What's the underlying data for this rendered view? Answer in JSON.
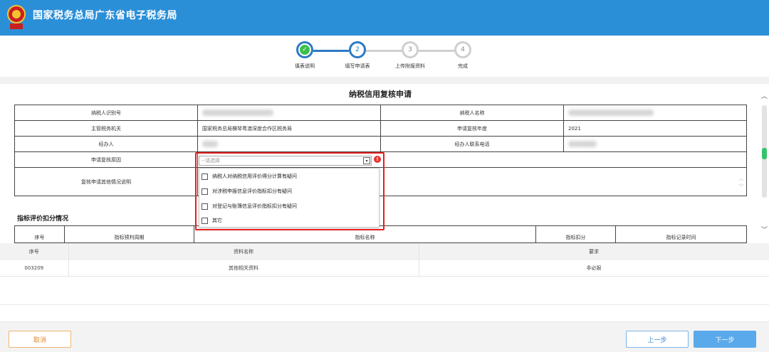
{
  "header": {
    "title": "国家税务总局广东省电子税务局",
    "brand_color": "#2b8fd8"
  },
  "stepper": {
    "steps": [
      {
        "number": "✓",
        "label": "填表说明",
        "state": "done"
      },
      {
        "number": "2",
        "label": "填写申请表",
        "state": "current"
      },
      {
        "number": "3",
        "label": "上传附报资料",
        "state": "todo"
      },
      {
        "number": "4",
        "label": "完成",
        "state": "todo"
      }
    ]
  },
  "form": {
    "title": "纳税信用复核申请",
    "rows": {
      "taxpayer_id_label": "纳税人识别号",
      "taxpayer_name_label": "纳税人名称",
      "tax_authority_label": "主管税务机关",
      "tax_authority_value": "国家税务总局横琴粤澳深度合作区税务局",
      "review_year_label": "申请复核年度",
      "review_year_value": "2021",
      "agent_label": "经办人",
      "agent_phone_label": "经办人联系电话",
      "reason_label": "申请复核原因",
      "other_label": "复核申请其他情况说明"
    },
    "reason_select": {
      "placeholder": "--请选择",
      "options": [
        "纳税人对纳税信用评价得分计算有疑问",
        "对涉税申报信息评价指标扣分有疑问",
        "对登记与账簿信息评价指标扣分有疑问",
        "其它"
      ]
    }
  },
  "index_section": {
    "title": "指标评价扣分情况",
    "columns": [
      "序号",
      "指标预判周期",
      "指标名称",
      "指标扣分",
      "指标记录时间"
    ]
  },
  "files": {
    "columns": [
      "序号",
      "资料名称",
      "要求"
    ],
    "rows": [
      {
        "no": "003209",
        "name": "其他相关资料",
        "requirement": "非必报"
      }
    ]
  },
  "footer": {
    "cancel": "取消",
    "prev": "上一步",
    "next": "下一步"
  }
}
